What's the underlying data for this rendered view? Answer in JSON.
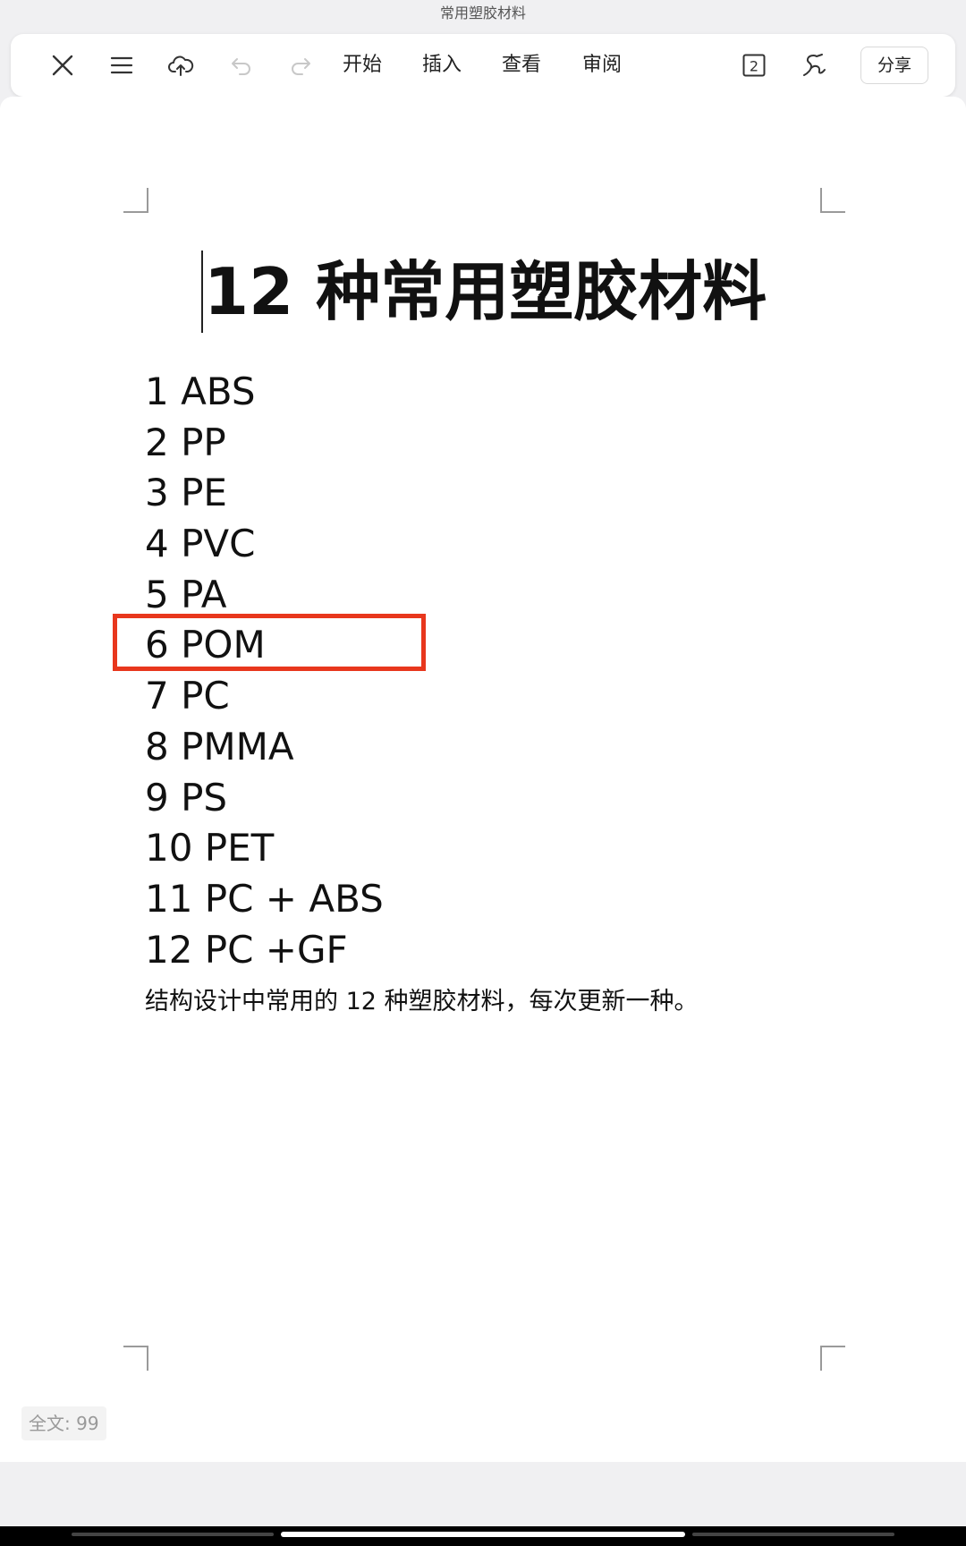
{
  "window": {
    "title": "常用塑胶材料"
  },
  "toolbar": {
    "icons": {
      "close": "close-icon",
      "menu": "list-menu-icon",
      "cloud": "cloud-upload-icon",
      "undo": "undo-icon",
      "redo": "redo-icon",
      "pages": "page-count-icon",
      "pen": "handwriting-pen-icon"
    },
    "menus": [
      "开始",
      "插入",
      "查看",
      "审阅"
    ],
    "page_badge": "2",
    "share_label": "分享"
  },
  "document": {
    "title": "12 种常用塑胶材料",
    "items": [
      "1 ABS",
      "2 PP",
      "3 PE",
      "4 PVC",
      "5 PA",
      "6 POM",
      "7 PC",
      "8 PMMA",
      "9 PS",
      "10 PET",
      "11 PC + ABS",
      "12 PC +GF"
    ],
    "highlighted_item": "6 POM",
    "caption": "结构设计中常用的 12 种塑胶材料，每次更新一种。"
  },
  "status": {
    "word_count": "全文: 99"
  },
  "colors": {
    "highlight": "#e8371d",
    "disabled_icon": "#c8c8c8",
    "text": "#111111"
  }
}
